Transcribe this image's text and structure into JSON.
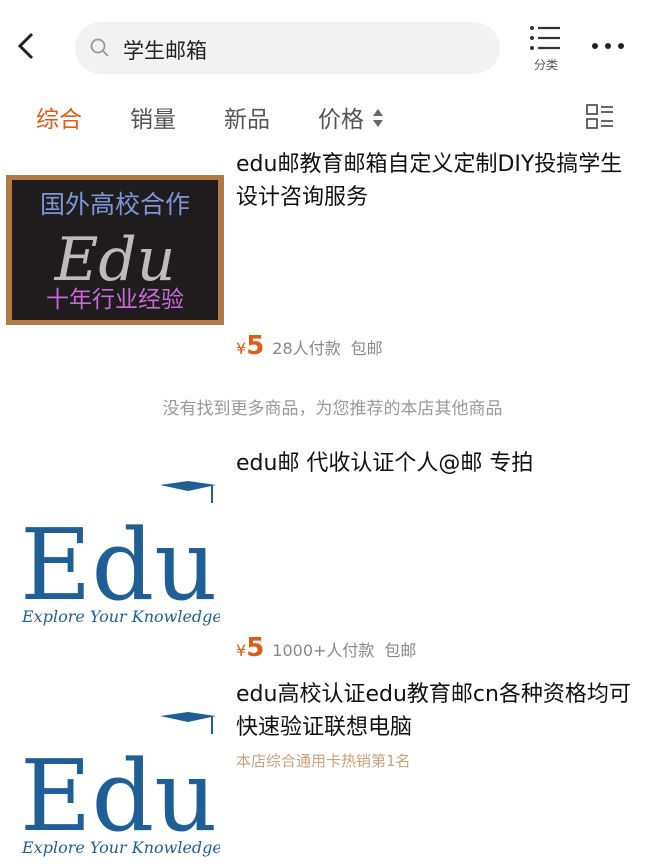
{
  "header": {
    "search_query": "学生邮箱",
    "category_label": "分类"
  },
  "filters": {
    "items": [
      "综合",
      "销量",
      "新品",
      "价格"
    ]
  },
  "products": [
    {
      "title": "edu邮教育邮箱自定义定制DIY投搞学生设计咨询服务",
      "image_text_top": "国外高校合作",
      "image_text_center": "Edu",
      "image_text_bottom": "十年行业经验",
      "currency": "¥",
      "price": "5",
      "sales": "28人付款",
      "shipping": "包邮"
    },
    {
      "title": "edu邮 代收认证个人@邮 专拍",
      "image_text_main": "Edu",
      "image_text_sub": "Explore Your Knowledge",
      "currency": "¥",
      "price": "5",
      "sales": "1000+人付款",
      "shipping": "包邮"
    },
    {
      "title": "edu高校认证edu教育邮cn各种资格均可快速验证联想电脑",
      "tag": "本店综合通用卡热销第1名",
      "image_text_main": "Edu",
      "image_text_sub": "Explore Your Knowledge"
    }
  ],
  "recommend_note": "没有找到更多商品，为您推荐的本店其他商品",
  "colors": {
    "accent": "#e25a13",
    "edu_blue": "#1f5f95",
    "chalkboard": "#1e1c1d",
    "frame": "#b07a45"
  }
}
